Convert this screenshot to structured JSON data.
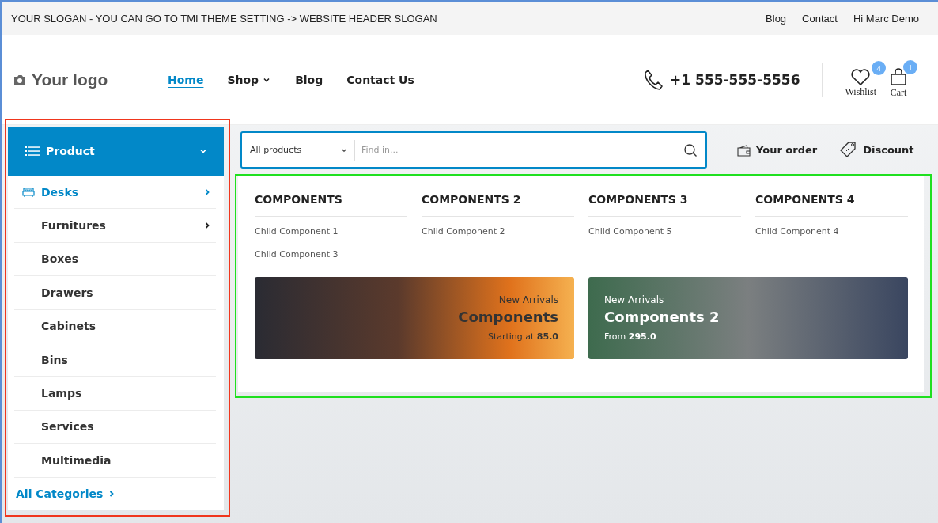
{
  "top_bar": {
    "slogan": "YOUR SLOGAN - YOU CAN GO TO TMI THEME SETTING -> WEBSITE HEADER SLOGAN",
    "links": [
      "Blog",
      "Contact",
      "Hi Marc Demo"
    ]
  },
  "header": {
    "logo": "Your logo",
    "nav": [
      {
        "label": "Home",
        "selected": true,
        "dropdown": false
      },
      {
        "label": "Shop",
        "selected": false,
        "dropdown": true
      },
      {
        "label": "Blog",
        "selected": false,
        "dropdown": false
      },
      {
        "label": "Contact Us",
        "selected": false,
        "dropdown": false
      }
    ],
    "phone": "+1 555-555-5556",
    "wishlist": {
      "label": "Wishlist",
      "count": "4"
    },
    "cart": {
      "label": "Cart",
      "count": "1"
    }
  },
  "category_menu": {
    "title": "Product",
    "items": [
      {
        "label": "Desks",
        "selected": true,
        "has_children": true
      },
      {
        "label": "Furnitures",
        "selected": false,
        "has_children": true
      },
      {
        "label": "Boxes",
        "selected": false,
        "has_children": false
      },
      {
        "label": "Drawers",
        "selected": false,
        "has_children": false
      },
      {
        "label": "Cabinets",
        "selected": false,
        "has_children": false
      },
      {
        "label": "Bins",
        "selected": false,
        "has_children": false
      },
      {
        "label": "Lamps",
        "selected": false,
        "has_children": false
      },
      {
        "label": "Services",
        "selected": false,
        "has_children": false
      },
      {
        "label": "Multimedia",
        "selected": false,
        "has_children": false
      }
    ],
    "all_link": "All Categories"
  },
  "search": {
    "category": "All products",
    "placeholder": "Find in..."
  },
  "actions": [
    {
      "kind": "order",
      "label": "Your order"
    },
    {
      "kind": "discount",
      "label": "Discount"
    }
  ],
  "mega_menu": {
    "columns": [
      {
        "title": "COMPONENTS",
        "links": [
          "Child Component 1",
          "Child Component 3"
        ]
      },
      {
        "title": "COMPONENTS 2",
        "links": [
          "Child Component 2"
        ]
      },
      {
        "title": "COMPONENTS 3",
        "links": [
          "Child Component 5"
        ]
      },
      {
        "title": "COMPONENTS 4",
        "links": [
          "Child Component 4"
        ]
      }
    ],
    "banners": [
      {
        "eyebrow": "New Arrivals",
        "title": "Components",
        "price": "Starting at **85.0**",
        "text_right": true
      },
      {
        "eyebrow": "New Arrivals",
        "title": "Components 2",
        "price": "From **295.0**",
        "text_right": false
      }
    ]
  }
}
